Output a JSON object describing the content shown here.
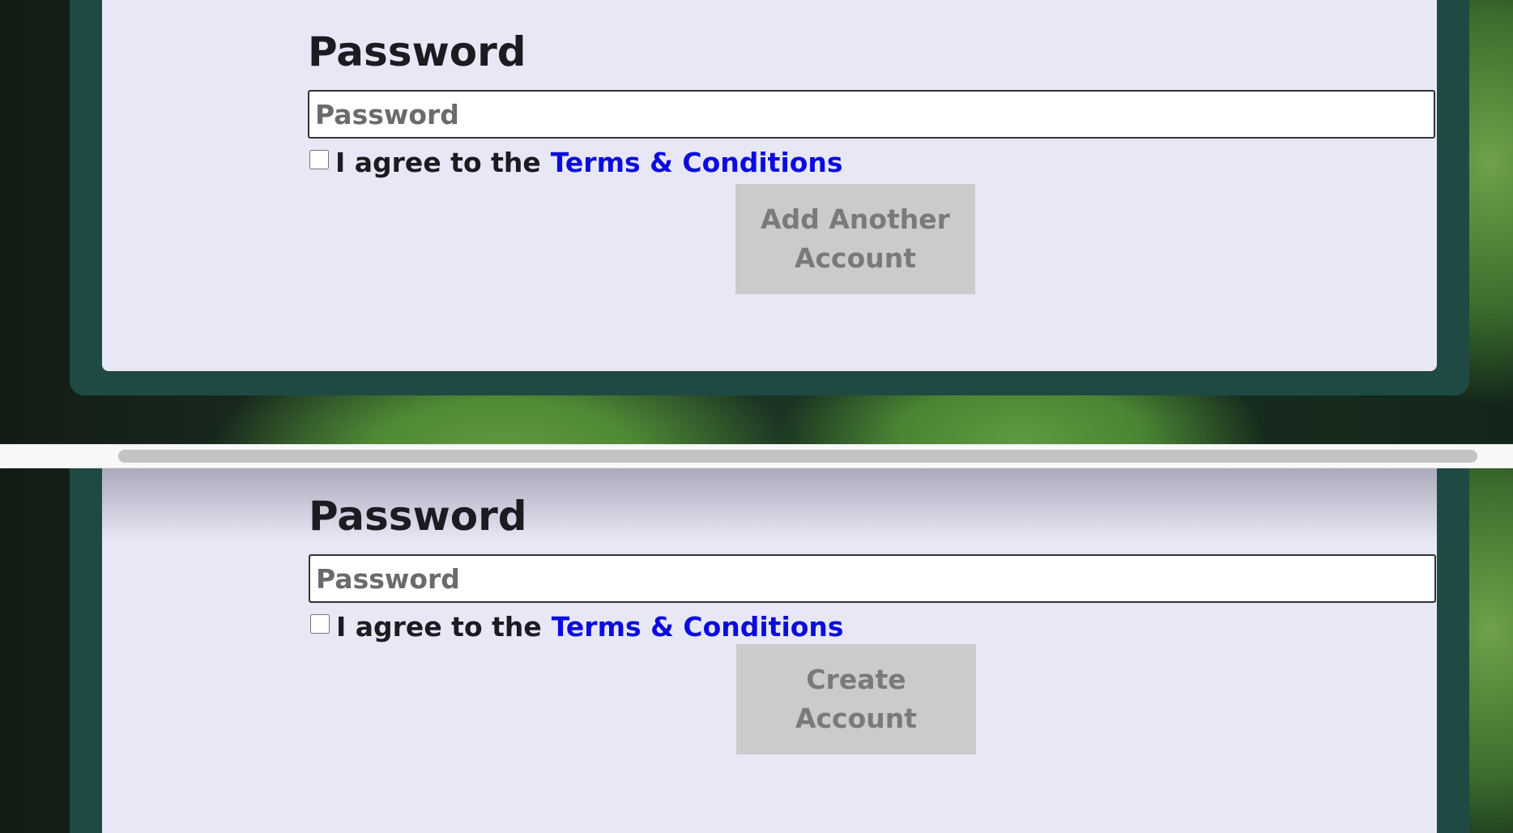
{
  "top_form": {
    "password_label": "Password",
    "password_placeholder": "Password",
    "agree_text": "I agree to the",
    "terms_link": "Terms & Conditions",
    "submit_label": "Add Another Account",
    "agree_checked": false
  },
  "bottom_form": {
    "password_label": "Password",
    "password_placeholder": "Password",
    "agree_text": "I agree to the",
    "terms_link": "Terms & Conditions",
    "submit_label": "Create Account",
    "agree_checked": false
  },
  "colors": {
    "card_background": "#e8e7f5",
    "outer_panel": "#1f4a44",
    "link": "#0b0be0",
    "disabled_button": "#cbcbcb",
    "disabled_button_text": "#7a7a7a"
  },
  "icons": {
    "checkbox": "checkbox-icon"
  }
}
